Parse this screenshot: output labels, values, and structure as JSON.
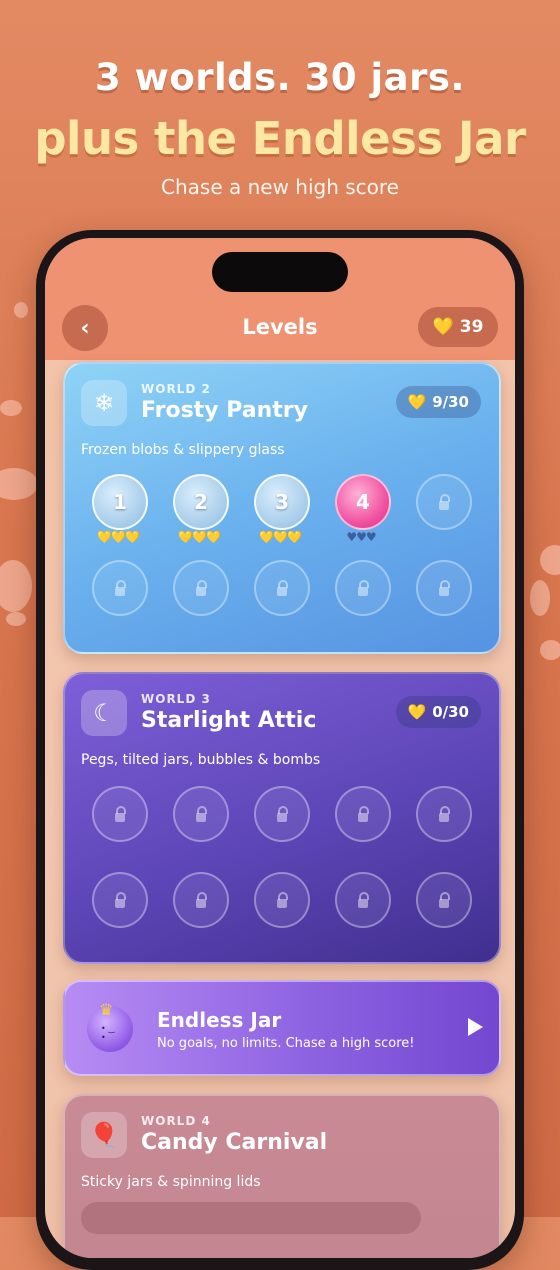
{
  "promo": {
    "line1": "3 worlds. 30 jars.",
    "line2": "plus the Endless Jar",
    "line3": "Chase a new high score"
  },
  "header": {
    "title": "Levels",
    "coins": "39",
    "back_icon": "chevron-left-icon",
    "coin_icon": "gold-heart-icon"
  },
  "worlds": [
    {
      "label": "WORLD 2",
      "name": "Frosty Pantry",
      "icon": "snowflake-icon",
      "progress": "9/30",
      "description": "Frozen blobs & slippery glass",
      "levels": [
        {
          "number": "1",
          "state": "completed",
          "stars": "💛💛💛"
        },
        {
          "number": "2",
          "state": "completed",
          "stars": "💛💛💛"
        },
        {
          "number": "3",
          "state": "completed",
          "stars": "💛💛💛"
        },
        {
          "number": "4",
          "state": "current",
          "stars": "♥♥♥"
        },
        {
          "number": "",
          "state": "locked"
        },
        {
          "number": "",
          "state": "locked"
        },
        {
          "number": "",
          "state": "locked"
        },
        {
          "number": "",
          "state": "locked"
        },
        {
          "number": "",
          "state": "locked"
        },
        {
          "number": "",
          "state": "locked"
        }
      ]
    },
    {
      "label": "WORLD 3",
      "name": "Starlight Attic",
      "icon": "moon-stars-icon",
      "progress": "0/30",
      "description": "Pegs, tilted jars, bubbles & bombs"
    },
    {
      "label": "WORLD 4",
      "name": "Candy Carnival",
      "icon": "balloon-icon",
      "description": "Sticky jars & spinning lids"
    }
  ],
  "endless": {
    "title": "Endless Jar",
    "description": "No goals, no limits. Chase a high score!",
    "icon": "crowned-blob-icon",
    "play_icon": "play-icon"
  },
  "colors": {
    "background": "#dc7a53",
    "header": "#ee9271",
    "gold": "#f7c939",
    "frosty": "#6ab1ee",
    "attic": "#5c45b6",
    "endless": "#8b60e0",
    "candy": "#c98a94"
  }
}
